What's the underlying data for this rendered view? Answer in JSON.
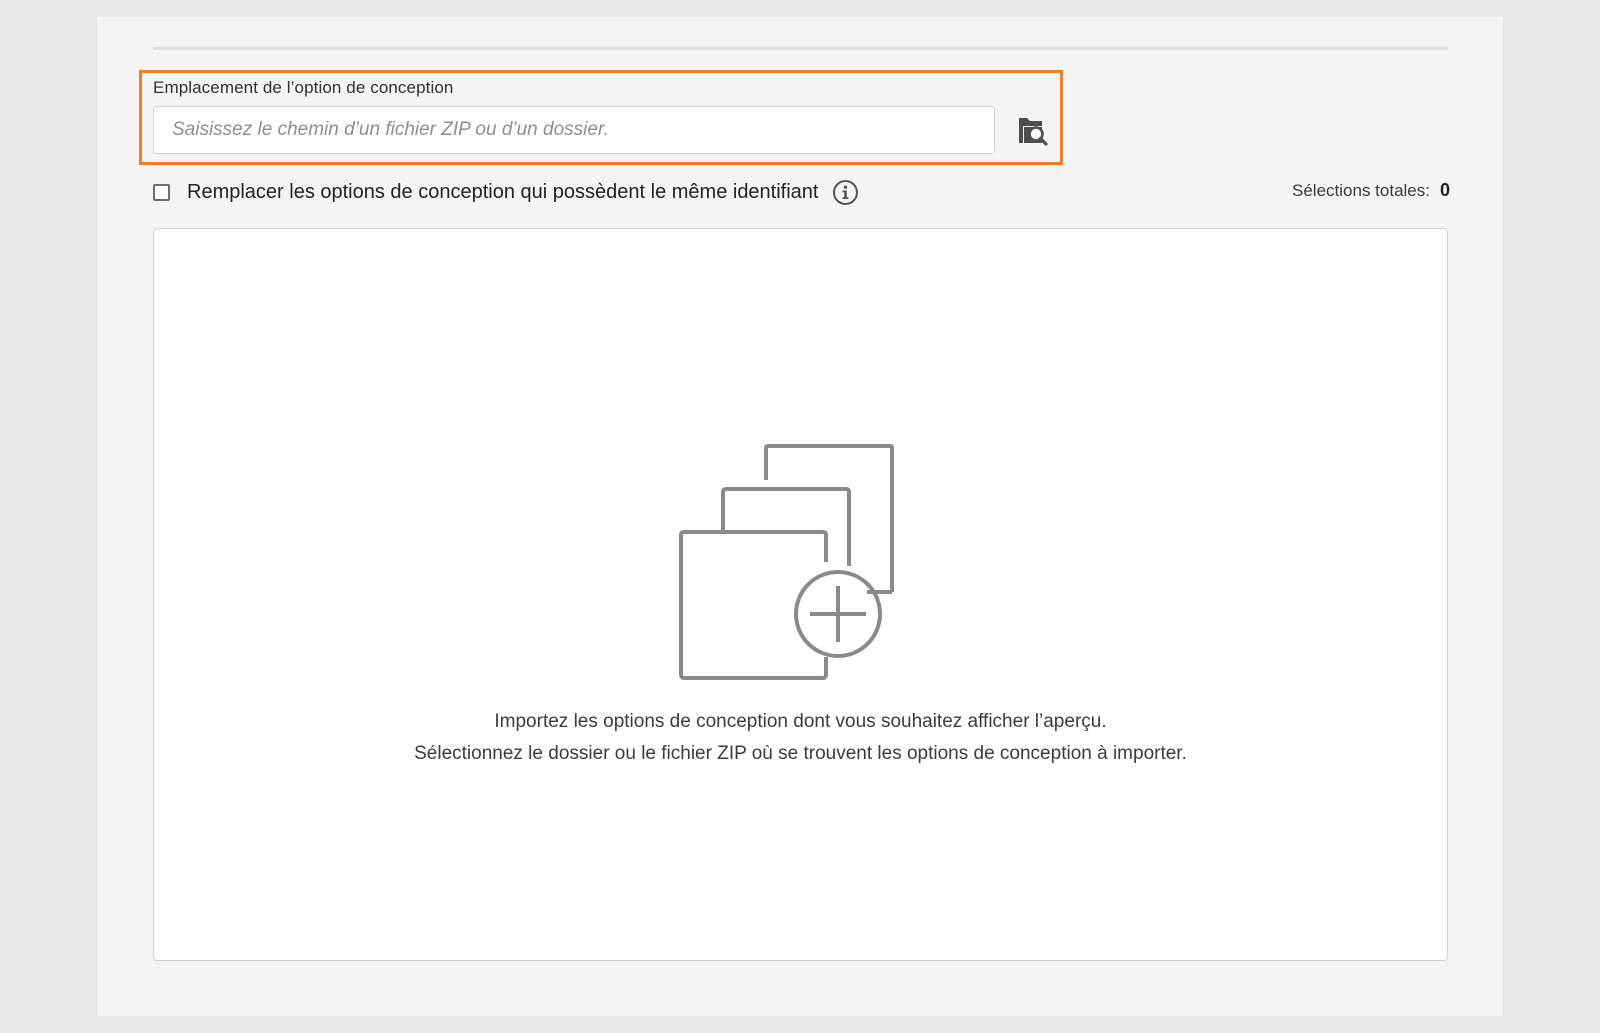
{
  "import_section": {
    "label": "Emplacement de l’option de conception",
    "path_placeholder": "Saisissez le chemin d’un fichier ZIP ou d’un dossier.",
    "path_value": "",
    "browse_icon": "folder-search-icon",
    "highlight_color": "#ef7f28"
  },
  "replace_option": {
    "label": "Remplacer les options de conception qui possèdent le même identifiant",
    "checked": false,
    "info_icon": "info-icon"
  },
  "selection_summary": {
    "label": "Sélections totales:",
    "count": "0"
  },
  "empty_state": {
    "illustration_icon": "stacked-pages-add-icon",
    "line1": "Importez les options de conception dont vous souhaitez afficher l’aperçu.",
    "line2": "Sélectionnez le dossier ou le fichier ZIP où se trouvent les options de conception à importer."
  }
}
